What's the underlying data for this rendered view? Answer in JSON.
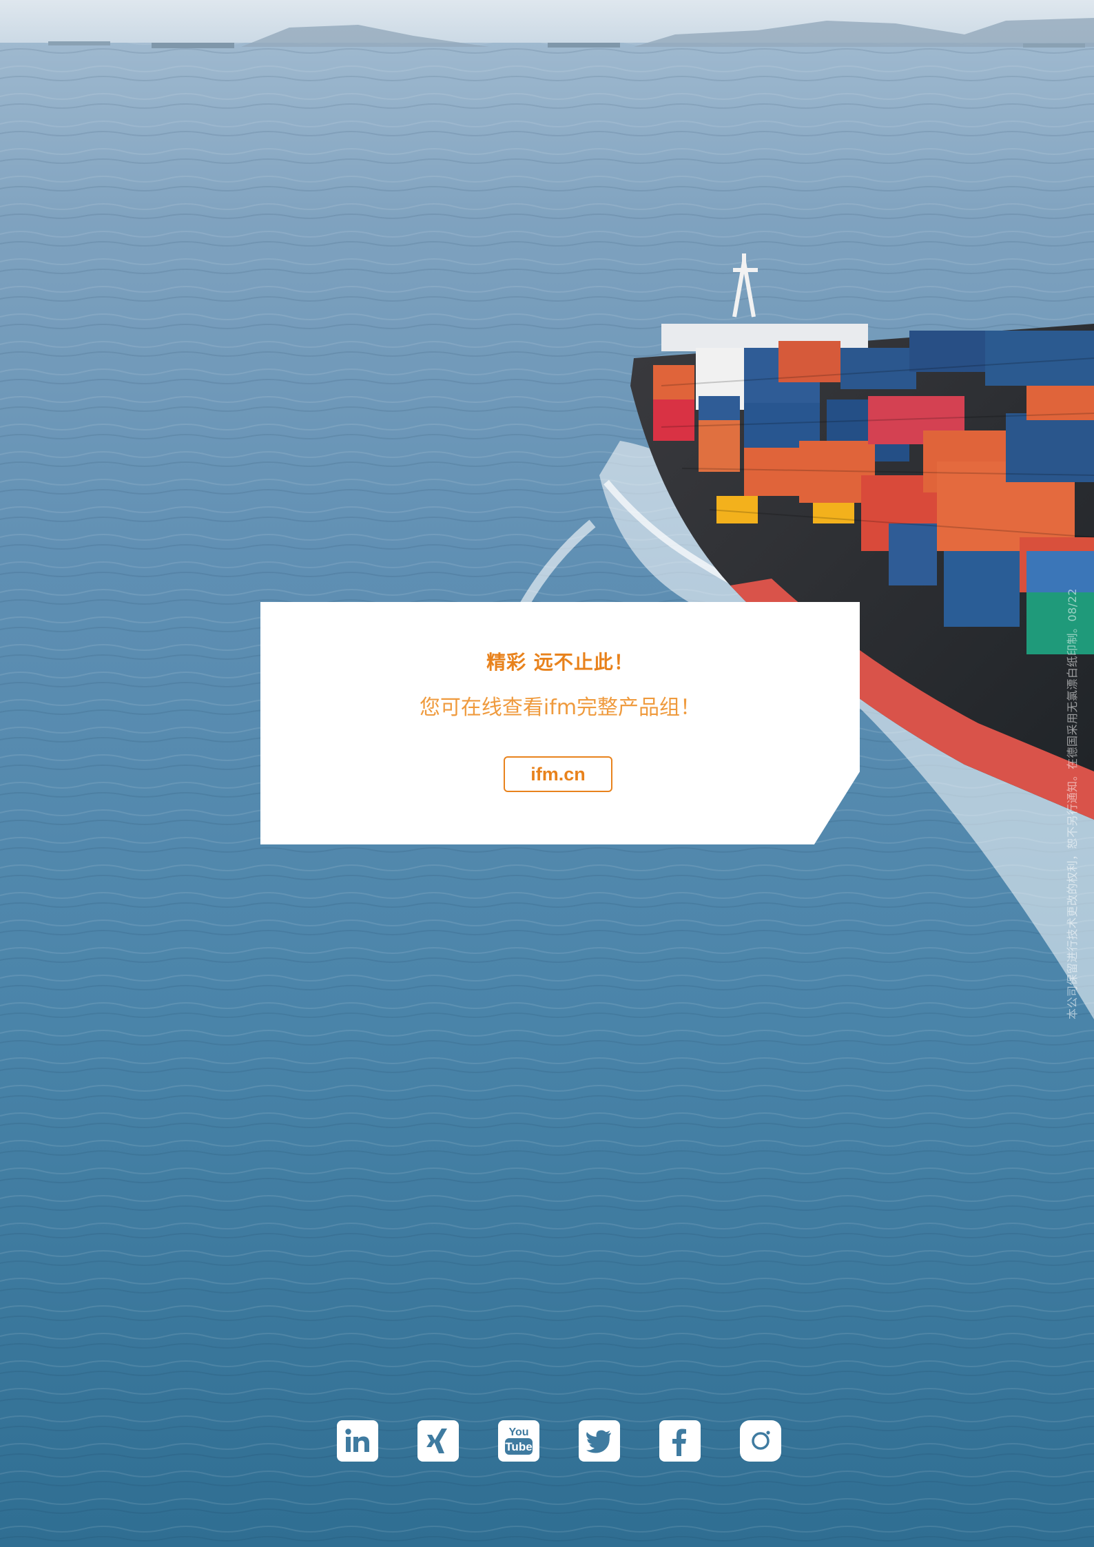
{
  "card": {
    "title": "精彩 远不止此！",
    "subtitle": "您可在线查看ifm完整产品组！",
    "link_label": "ifm.cn"
  },
  "side_note": "本公司保留进行技术更改的权利，恕不另行通知。在德国采用无氯漂白纸印制。08/22",
  "social_icons": [
    "linkedin-icon",
    "xing-icon",
    "youtube-icon",
    "twitter-icon",
    "facebook-icon",
    "instagram-icon"
  ],
  "youtube_icon_text": [
    "You",
    "Tube"
  ],
  "colors": {
    "accent_orange": "#e8821c",
    "sea_blue": "#3f7ba0",
    "card_bg": "#ffffff"
  }
}
